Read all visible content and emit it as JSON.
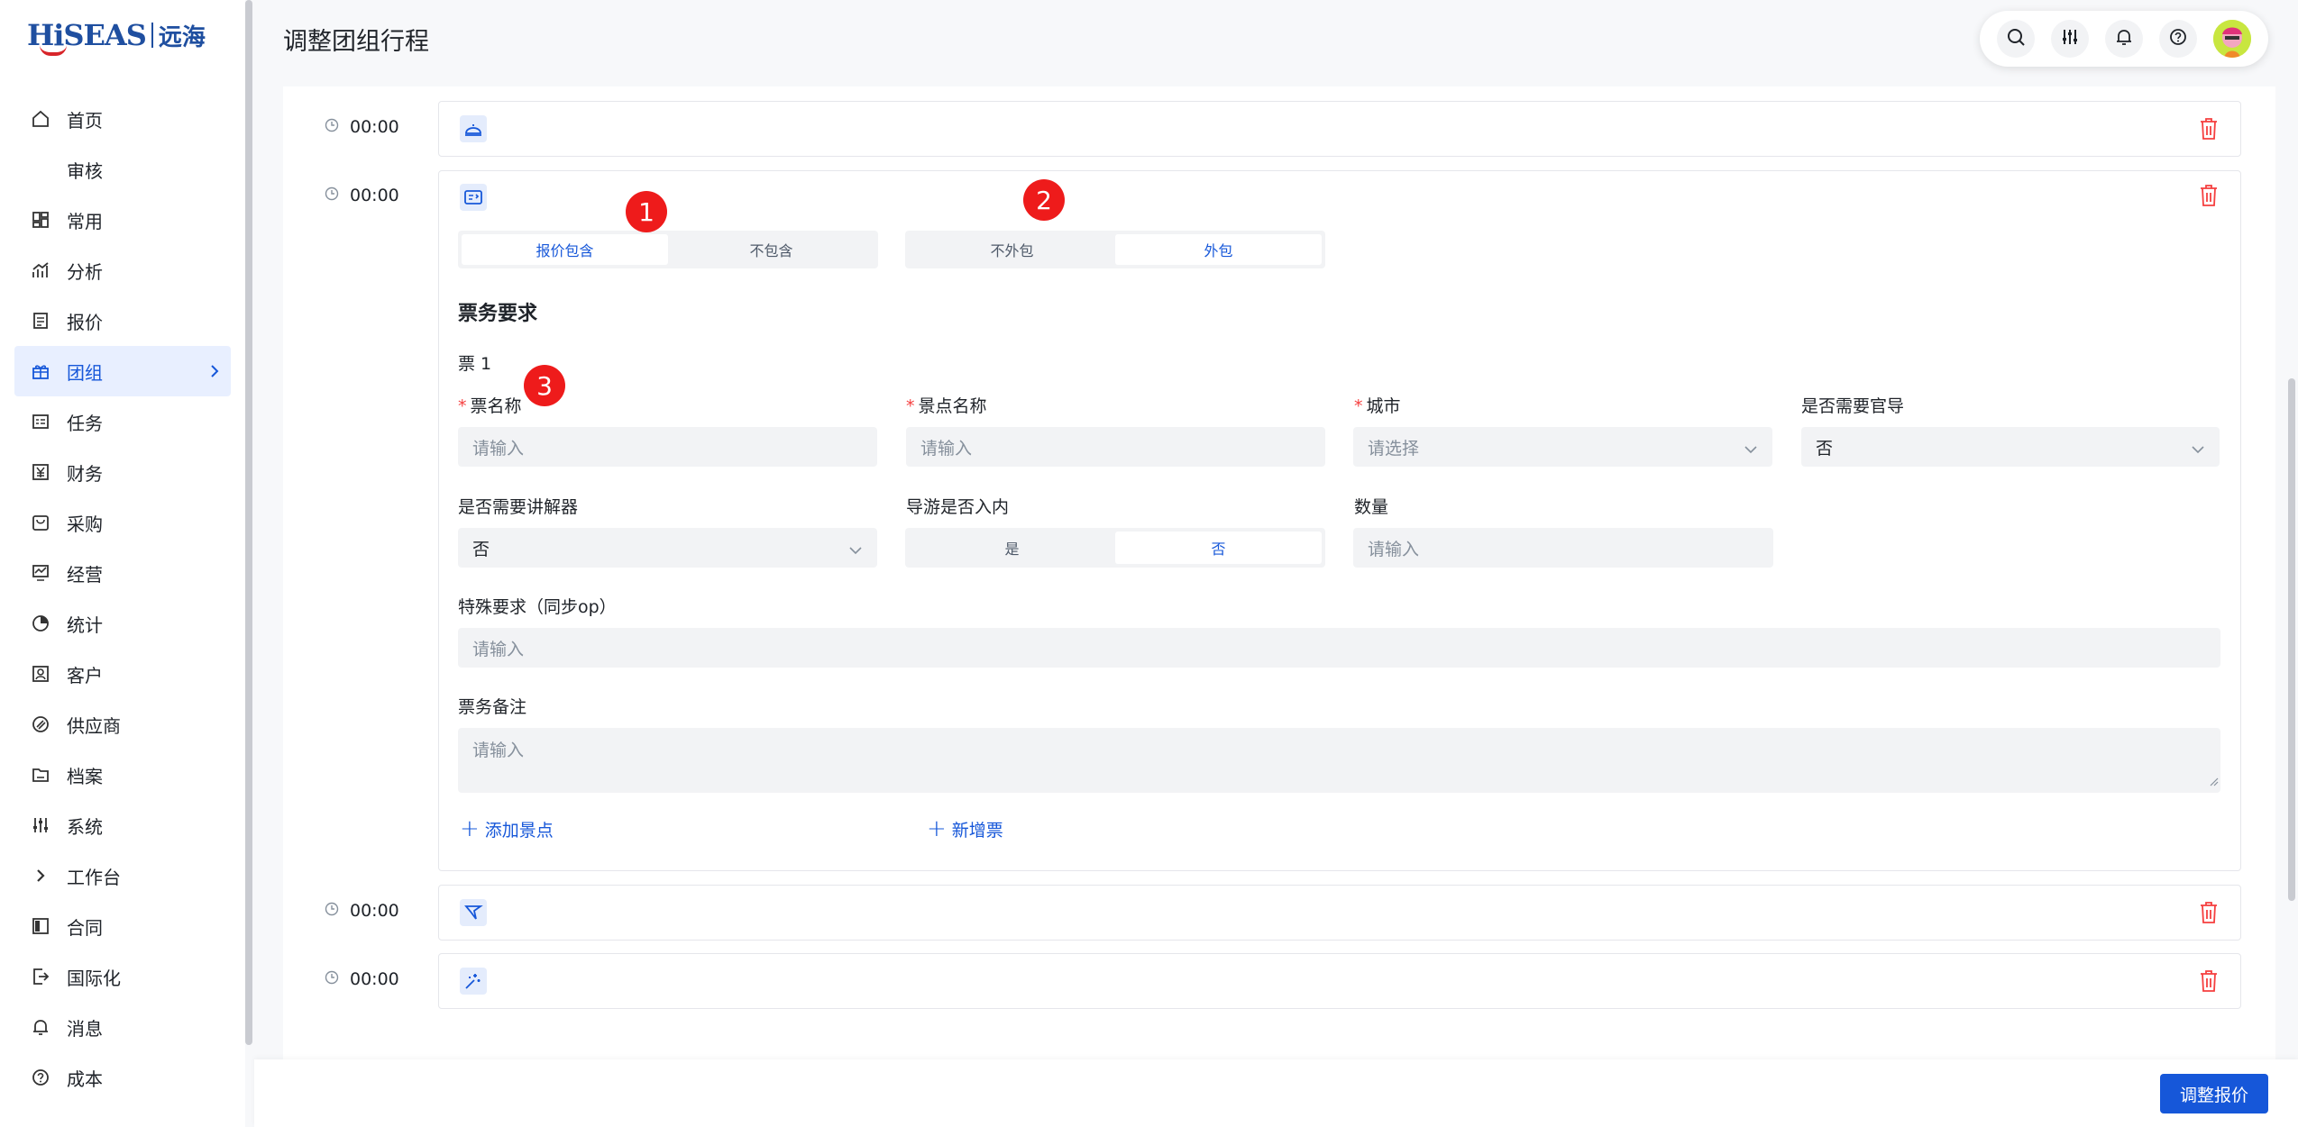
{
  "app": {
    "logo_brand": "HiSEAS",
    "logo_cn": "远海",
    "page_title": "调整团组行程"
  },
  "sidebar": {
    "items": [
      {
        "label": "首页",
        "icon": "home-icon"
      },
      {
        "label": "审核",
        "icon": ""
      },
      {
        "label": "常用",
        "icon": "grid-icon"
      },
      {
        "label": "分析",
        "icon": "trend-icon"
      },
      {
        "label": "报价",
        "icon": "document-icon"
      },
      {
        "label": "团组",
        "icon": "gift-icon"
      },
      {
        "label": "任务",
        "icon": "task-icon"
      },
      {
        "label": "财务",
        "icon": "yen-icon"
      },
      {
        "label": "采购",
        "icon": "bag-icon"
      },
      {
        "label": "经营",
        "icon": "monitor-icon"
      },
      {
        "label": "统计",
        "icon": "pie-icon"
      },
      {
        "label": "客户",
        "icon": "contact-icon"
      },
      {
        "label": "供应商",
        "icon": "link-icon"
      },
      {
        "label": "档案",
        "icon": "folder-icon"
      },
      {
        "label": "系统",
        "icon": "sliders-icon"
      },
      {
        "label": "工作台",
        "icon": "chevron-right-icon"
      },
      {
        "label": "合同",
        "icon": "contract-icon"
      },
      {
        "label": "国际化",
        "icon": "exit-icon"
      },
      {
        "label": "消息",
        "icon": "bell-icon"
      },
      {
        "label": "成本",
        "icon": "help-icon"
      }
    ],
    "active_index": 5
  },
  "header": {
    "icons": [
      "search-icon",
      "sliders-icon",
      "bell-icon",
      "help-icon",
      "avatar"
    ]
  },
  "timeline": {
    "rows": [
      {
        "time": "00:00",
        "icon": "dish-icon"
      },
      {
        "time": "00:00",
        "icon": "ticket-icon"
      },
      {
        "time": "00:00",
        "icon": "flag-icon"
      },
      {
        "time": "00:00",
        "icon": "magic-icon"
      }
    ]
  },
  "ticket_card": {
    "seg1": {
      "options": [
        "报价包含",
        "不包含"
      ],
      "selected": 0
    },
    "seg2": {
      "options": [
        "不外包",
        "外包"
      ],
      "selected": 1
    },
    "badges": [
      "1",
      "2",
      "3"
    ],
    "section_title": "票务要求",
    "ticket_label": "票 1",
    "fields": {
      "ticket_name": {
        "label": "票名称",
        "placeholder": "请输入"
      },
      "spot_name": {
        "label": "景点名称",
        "placeholder": "请输入"
      },
      "city": {
        "label": "城市",
        "placeholder": "请选择"
      },
      "need_official_guide": {
        "label": "是否需要官导",
        "value": "否"
      },
      "need_explainer": {
        "label": "是否需要讲解器",
        "value": "否"
      },
      "guide_enter": {
        "label": "导游是否入内",
        "options": [
          "是",
          "否"
        ],
        "selected": 1
      },
      "quantity": {
        "label": "数量",
        "placeholder": "请输入"
      },
      "special_req": {
        "label": "特殊要求（同步op）",
        "placeholder": "请输入"
      },
      "ticket_note": {
        "label": "票务备注",
        "placeholder": "请输入"
      }
    },
    "add_spot": "添加景点",
    "add_ticket": "新增票"
  },
  "footer": {
    "submit_label": "调整报价"
  },
  "colors": {
    "primary": "#1657d9",
    "danger": "#f53f3f",
    "badge": "#ee1b1b"
  }
}
